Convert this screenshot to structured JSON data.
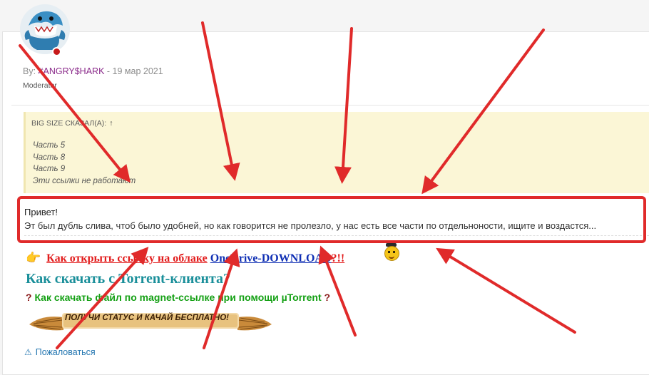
{
  "post": {
    "by_label": "By:",
    "username": "#ANGRY$HARK",
    "separator": "-",
    "date": "19 мар 2021",
    "role": "Moderator"
  },
  "quote": {
    "author_line": "BIG SIZE СКАЗАЛ(А):",
    "up_arrow": "↑",
    "lines": [
      "Часть 5",
      "Часть 8",
      "Часть 9",
      "Эти ссылки не работают"
    ]
  },
  "message": {
    "greeting": "Привет!",
    "body": "Эт был дубль слива, чтоб было удобней, но как говорится не пролезло, у нас есть все части по отдельноности, ищите и воздастся..."
  },
  "links": {
    "onedrive_prefix": "Как открыть ссылку на облаке",
    "onedrive_brand": "OneDrive-DOWNLOAD",
    "onedrive_suffix": "?!!",
    "torrent": "Как скачать с Torrent-клиента?",
    "magnet": "Как скачать файл по magnet-ссылке при помощи µTorrent",
    "qmark": "?"
  },
  "banner": {
    "text": "ПОЛУЧИ СТАТУС И КАЧАЙ БЕСПЛАТНО!"
  },
  "actions": {
    "report": "Пожаловаться"
  },
  "colors": {
    "accent_red": "#e02a2a",
    "username": "#8a2a8a",
    "quote_bg": "#fbf6d6",
    "link_blue": "#2577b1"
  },
  "icons": {
    "report": "warning-triangle-icon",
    "hand": "pointing-hand-icon",
    "smiley": "smiley-icon"
  }
}
